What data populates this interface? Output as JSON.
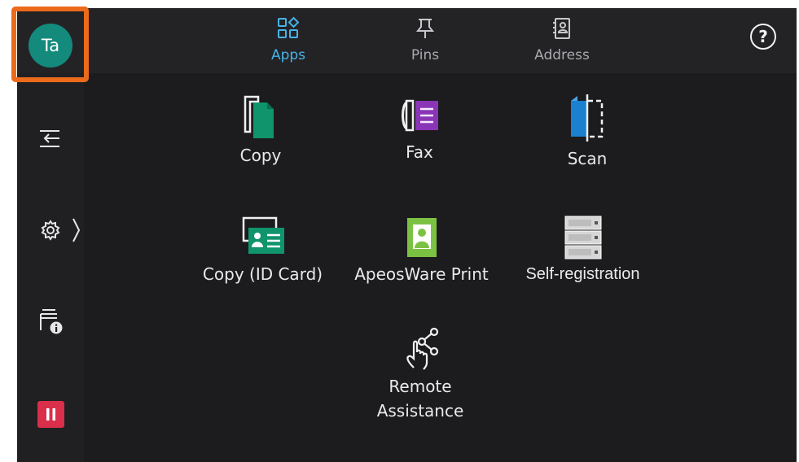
{
  "user": {
    "initials": "Ta"
  },
  "tabs": [
    {
      "label": "Apps",
      "icon": "apps-grid-icon",
      "active": true
    },
    {
      "label": "Pins",
      "icon": "pin-icon",
      "active": false
    },
    {
      "label": "Address",
      "icon": "address-book-icon",
      "active": false
    }
  ],
  "help": {
    "icon": "help-icon",
    "glyph": "?"
  },
  "sidebar": [
    {
      "name": "job-switch",
      "icon": "switch-arrows-icon"
    },
    {
      "name": "device-settings",
      "icon": "gear-icon"
    },
    {
      "name": "job-status",
      "icon": "job-info-icon"
    },
    {
      "name": "stop",
      "icon": "stop-icon"
    }
  ],
  "apps": [
    {
      "label": "Copy",
      "icon": "copy-icon"
    },
    {
      "label": "Fax",
      "icon": "fax-icon"
    },
    {
      "label": "Scan",
      "icon": "scan-icon"
    },
    {
      "label": "Copy (ID Card)",
      "icon": "id-card-copy-icon"
    },
    {
      "label": "ApeosWare Print",
      "icon": "user-print-icon"
    },
    {
      "label": "Self-registration",
      "icon": "server-icon"
    },
    {
      "label": "Remote\nAssistance",
      "icon": "remote-assistance-icon"
    }
  ],
  "colors": {
    "accent": "#47b4e8",
    "avatar": "#138a7c",
    "highlight": "#ec6a1c",
    "stop": "#d92f4b",
    "copy_green": "#10946b",
    "fax_purple": "#8a35b8",
    "scan_blue": "#1a80cf",
    "id_green": "#10946b",
    "apeos_green": "#7cc242"
  }
}
